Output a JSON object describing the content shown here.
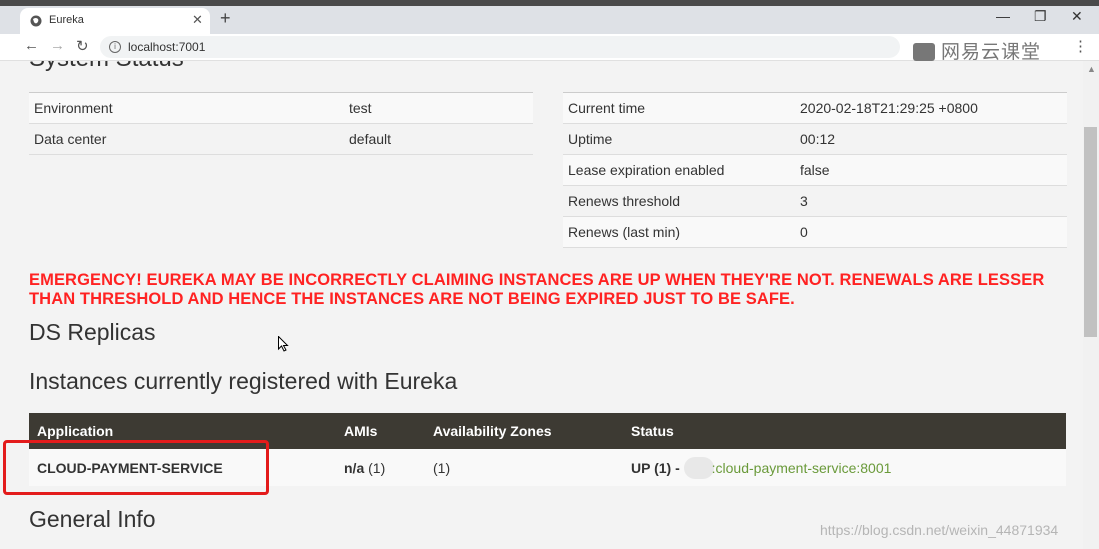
{
  "browser": {
    "tab_title": "Eureka",
    "new_tab": "+",
    "url": "localhost:7001",
    "brand": "网易云课堂",
    "window_controls": {
      "minimize": "—",
      "maximize": "❐",
      "close": "✕"
    }
  },
  "page": {
    "system_status_heading": "System Status",
    "left_status": [
      {
        "label": "Environment",
        "value": "test"
      },
      {
        "label": "Data center",
        "value": "default"
      }
    ],
    "right_status": [
      {
        "label": "Current time",
        "value": "2020-02-18T21:29:25 +0800"
      },
      {
        "label": "Uptime",
        "value": "00:12"
      },
      {
        "label": "Lease expiration enabled",
        "value": "false"
      },
      {
        "label": "Renews threshold",
        "value": "3"
      },
      {
        "label": "Renews (last min)",
        "value": "0"
      }
    ],
    "emergency": "EMERGENCY! EUREKA MAY BE INCORRECTLY CLAIMING INSTANCES ARE UP WHEN THEY'RE NOT. RENEWALS ARE LESSER THAN THRESHOLD AND HENCE THE INSTANCES ARE NOT BEING EXPIRED JUST TO BE SAFE.",
    "ds_replicas_heading": "DS Replicas",
    "instances_heading": "Instances currently registered with Eureka",
    "instances_table": {
      "headers": [
        "Application",
        "AMIs",
        "Availability Zones",
        "Status"
      ],
      "rows": [
        {
          "application": "CLOUD-PAYMENT-SERVICE",
          "amis_bold": "n/a",
          "amis_count": " (1)",
          "zones": "(1)",
          "status_prefix": "UP (1) - ",
          "status_link": ":cloud-payment-service:8001"
        }
      ]
    },
    "general_info_heading": "General Info"
  },
  "watermark": "https://blog.csdn.net/weixin_44871934",
  "colors": {
    "emergency": "#ff2222",
    "table_header": "#3d3a33",
    "link": "#6a9a3a",
    "highlight": "#e31b1b"
  }
}
